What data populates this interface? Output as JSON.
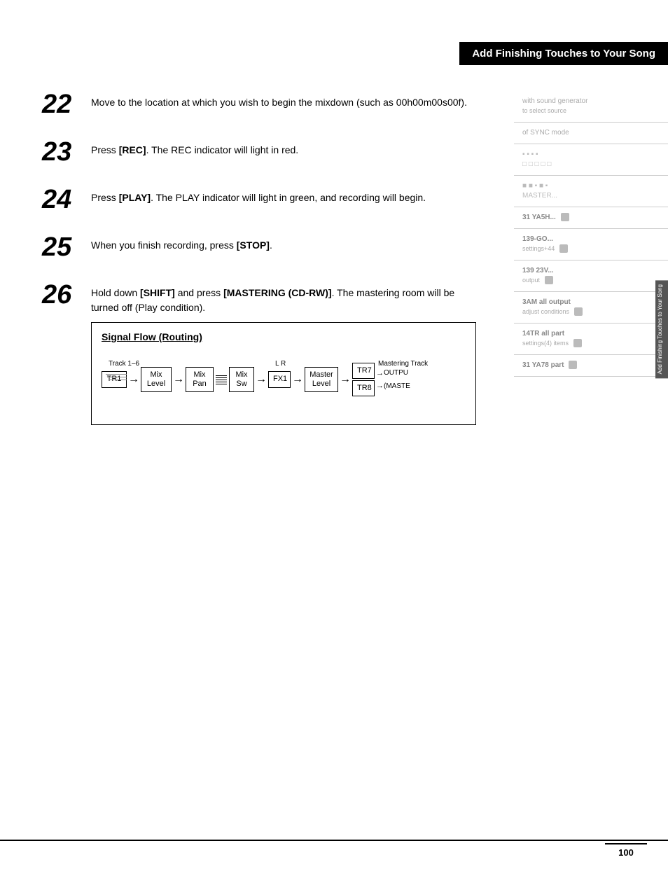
{
  "header": {
    "title": "Add Finishing Touches to Your Song"
  },
  "steps": [
    {
      "number": "22",
      "content": "Move to the location at which you wish to begin the mixdown (such as 00h00m00s00f)."
    },
    {
      "number": "23",
      "content_plain": "Press ",
      "content_bold": "[REC]",
      "content_rest": ". The REC indicator will light in red."
    },
    {
      "number": "24",
      "content_plain": "Press ",
      "content_bold": "[PLAY]",
      "content_rest": ". The PLAY indicator will light in green, and recording will begin."
    },
    {
      "number": "25",
      "content_plain": "When you finish recording, press ",
      "content_bold": "[STOP]",
      "content_rest": "."
    },
    {
      "number": "26",
      "content_plain": "Hold down ",
      "content_bold1": "[SHIFT]",
      "content_mid": " and press ",
      "content_bold2": "[MASTERING (CD-RW)]",
      "content_rest": ". The mastering room will be turned off (Play condition)."
    }
  ],
  "signal_flow": {
    "title": "Signal Flow (Routing)",
    "label_track": "Track 1–6",
    "label_lr": "L  R",
    "label_mastering": "Mastering Track",
    "boxes": [
      "TR1",
      "Mix\nLevel",
      "Mix\nPan",
      "Mix\nSw",
      "FX1",
      "Master\nLevel",
      "TR7",
      "TR8"
    ],
    "output_labels": [
      "OUTPUT",
      "(MASTE"
    ]
  },
  "sidebar": {
    "sections": [
      {
        "num": "",
        "text": "with sound generator",
        "icon": true
      },
      {
        "num": "",
        "text": "to select source",
        "icon": false
      },
      {
        "num": "",
        "text": "of SYNC mode",
        "icon": false
      },
      {
        "num": "",
        "text": "⬜⬜⬜⬜",
        "icon": false
      },
      {
        "num": "",
        "text": "□□□□□□",
        "icon": false
      },
      {
        "num": "",
        "text": "⬜⬜⬛⬜⬛",
        "icon": false
      },
      {
        "num": "",
        "text": "MASTER...",
        "icon": false
      },
      {
        "num": "31 YASH...",
        "text": "",
        "icon": true
      },
      {
        "num": "139-GO...",
        "text": "settings+44",
        "icon": true
      },
      {
        "num": "139 23V...",
        "text": "output",
        "icon": true
      },
      {
        "num": "31M all output",
        "text": "adjust conditions",
        "icon": true
      },
      {
        "num": "14TR all part",
        "text": "settings(4) items",
        "icon": true
      },
      {
        "num": "31 YA78 part",
        "text": "",
        "icon": true
      }
    ]
  },
  "vertical_tab": {
    "text": "Add Finishing Touches to Your Song"
  },
  "page": {
    "number": "100"
  }
}
